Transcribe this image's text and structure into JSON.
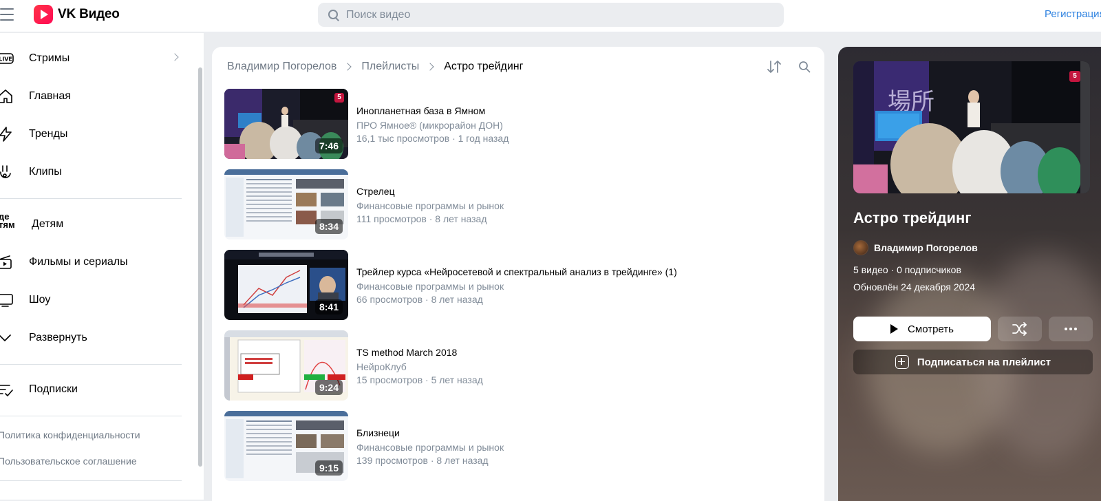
{
  "header": {
    "logo_text": "VK Видео",
    "search_placeholder": "Поиск видео",
    "register_label": "Регистрация"
  },
  "sidebar": {
    "items": [
      {
        "label": "Стримы",
        "icon": "live-icon"
      },
      {
        "label": "Главная",
        "icon": "home-icon"
      },
      {
        "label": "Тренды",
        "icon": "lightning-icon"
      },
      {
        "label": "Клипы",
        "icon": "clips-icon"
      },
      {
        "label": "Детям",
        "icon": "kids-icon",
        "icon_text": "де\nтям"
      },
      {
        "label": "Фильмы и сериалы",
        "icon": "movies-icon"
      },
      {
        "label": "Шоу",
        "icon": "tv-icon"
      },
      {
        "label": "Развернуть",
        "icon": "chevron-down-icon"
      },
      {
        "label": "Подписки",
        "icon": "subscriptions-icon"
      }
    ],
    "footer": [
      "Политика конфиденциальности",
      "Пользовательское соглашение"
    ]
  },
  "main": {
    "breadcrumbs": [
      "Владимир Погорелов",
      "Плейлисты",
      "Астро трейдинг"
    ],
    "videos": [
      {
        "title": "Инопланетная база в Ямном",
        "channel": "ПРО Ямное® (микрорайон ДОН)",
        "meta": "16,1 тыс просмотров · 1 год назад",
        "duration": "7:46",
        "badge": "5"
      },
      {
        "title": "Стрелец",
        "channel": "Финансовые программы и рынок",
        "meta": "111 просмотров · 8 лет назад",
        "duration": "8:34"
      },
      {
        "title": "Трейлер курса «Нейросетевой и спектральный анализ в трейдинге» (1)",
        "channel": "Финансовые программы и рынок",
        "meta": "66 просмотров · 8 лет назад",
        "duration": "8:41"
      },
      {
        "title": "TS method March 2018",
        "channel": "НейроКлуб",
        "meta": "15 просмотров · 5 лет назад",
        "duration": "9:24"
      },
      {
        "title": "Близнеци",
        "channel": "Финансовые программы и рынок",
        "meta": "139 просмотров · 8 лет назад",
        "duration": "9:15"
      }
    ]
  },
  "playlist": {
    "title": "Астро трейдинг",
    "owner": "Владимир Погорелов",
    "stats": "5 видео · 0 подписчиков",
    "updated": "Обновлён 24 декабря 2024",
    "watch_label": "Смотреть",
    "subscribe_label": "Подписаться на плейлист",
    "cover_badge": "5"
  },
  "colors": {
    "accent": "#2d81e0",
    "background": "#ebedf0",
    "secondary_text": "#818c99"
  }
}
